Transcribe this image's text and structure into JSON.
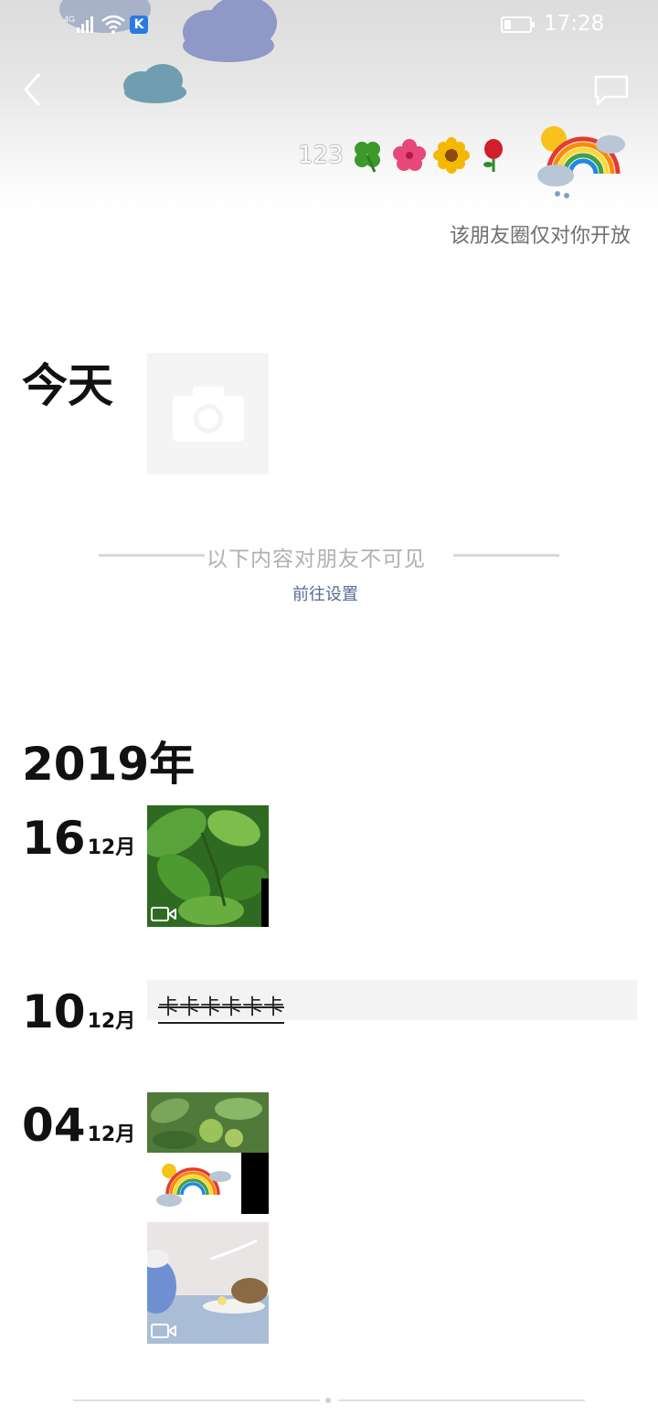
{
  "status_bar": {
    "network": "4G",
    "badge": "K",
    "time": "17:28",
    "battery_level": 0.25
  },
  "header": {
    "nickname": "123",
    "nickname_emojis": [
      "four-leaf-clover-emoji",
      "hibiscus-emoji",
      "sunflower-emoji",
      "rose-emoji"
    ],
    "visibility_note": "该朋友圈仅对你开放"
  },
  "today": {
    "label": "今天"
  },
  "hidden_divider": {
    "text": "以下内容对朋友不可见",
    "link": "前往设置"
  },
  "timeline": {
    "year": "2019年",
    "entries": [
      {
        "day": "16",
        "month": "12月",
        "type": "video"
      },
      {
        "day": "10",
        "month": "12月",
        "type": "text",
        "text": "卡卡卡卡卡卡"
      },
      {
        "day": "04",
        "month": "12月",
        "type": "images+video"
      }
    ]
  },
  "colors": {
    "link": "#576b95",
    "note_gray": "#b0b0b0",
    "text_post_bg": "#f3f3f3"
  }
}
